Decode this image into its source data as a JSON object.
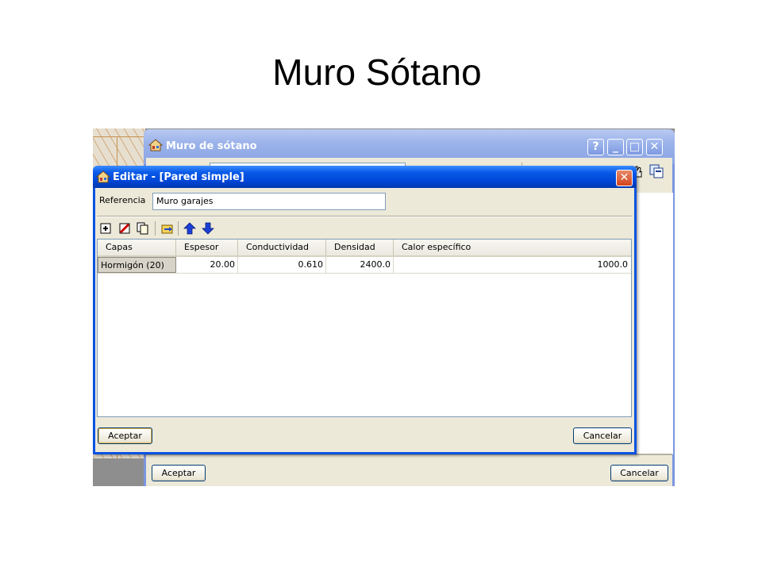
{
  "slide": {
    "title": "Muro Sótano"
  },
  "outer_window": {
    "title": "Muro de sótano",
    "help_label": "?",
    "minimize_label": "_",
    "maximize_label": "□",
    "close_label": "✕",
    "accept_label": "Aceptar",
    "cancel_label": "Cancelar"
  },
  "inner_window": {
    "title": "Editar - [Pared simple]",
    "close_label": "✕",
    "reference_label": "Referencia",
    "reference_value": "Muro garajes",
    "toolbar": [
      "add-icon",
      "delete-icon",
      "copy-icon",
      "import-icon",
      "arrow-up-icon",
      "arrow-down-icon"
    ],
    "table": {
      "columns": [
        "Capas",
        "Espesor",
        "Conductividad",
        "Densidad",
        "Calor específico"
      ],
      "rows": [
        [
          "Hormigón (20)",
          "20.00",
          "0.610",
          "2400.0",
          "1000.0"
        ]
      ]
    },
    "accept_label": "Aceptar",
    "cancel_label": "Cancelar"
  },
  "colors": {
    "inner_titlebar": "#0a5ae8",
    "outer_titlebar_inactive": "#9bb2ea",
    "dialog_face": "#ece9d8"
  }
}
